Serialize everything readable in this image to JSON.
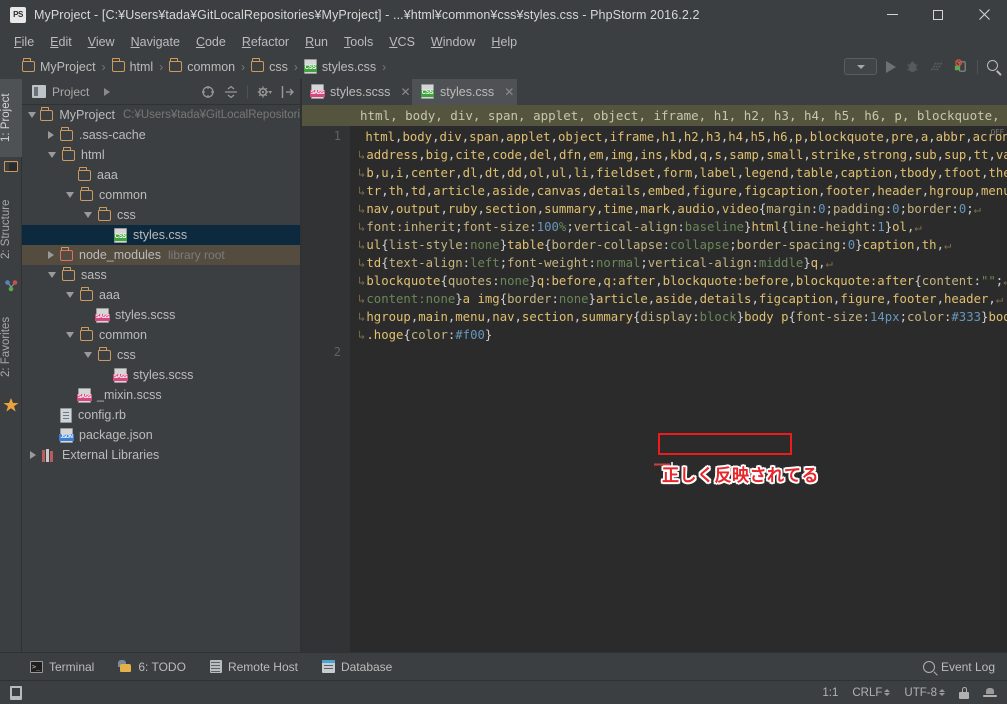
{
  "window": {
    "title": "MyProject - [C:¥Users¥tada¥GitLocalRepositories¥MyProject] - ...¥html¥common¥css¥styles.css - PhpStorm 2016.2.2",
    "app_icon_text": "PS",
    "minimize_label": "–",
    "maximize_label": "▫",
    "close_label": "✕"
  },
  "menubar": {
    "items": [
      {
        "label": "File"
      },
      {
        "label": "Edit"
      },
      {
        "label": "View"
      },
      {
        "label": "Navigate"
      },
      {
        "label": "Code"
      },
      {
        "label": "Refactor"
      },
      {
        "label": "Run"
      },
      {
        "label": "Tools"
      },
      {
        "label": "VCS"
      },
      {
        "label": "Window"
      },
      {
        "label": "Help"
      }
    ]
  },
  "breadcrumb": {
    "separator": "›",
    "items": [
      {
        "label": "MyProject",
        "icon": "folder-icon"
      },
      {
        "label": "html",
        "icon": "folder-icon"
      },
      {
        "label": "common",
        "icon": "folder-icon"
      },
      {
        "label": "css",
        "icon": "folder-icon"
      },
      {
        "label": "styles.css",
        "icon": "css-file-icon"
      }
    ]
  },
  "toolbar_right": {
    "run_config_label": "",
    "icons": [
      "run-config-dropdown",
      "run-icon",
      "debug-icon",
      "coverage-icon",
      "stop-profile-icon",
      "search-everywhere-icon"
    ]
  },
  "left_tool_tabs": [
    {
      "label": "1: Project",
      "active": true,
      "icon": "project-icon"
    },
    {
      "label": "2: Structure",
      "active": false,
      "icon": "structure-icon"
    },
    {
      "label": "2: Favorites",
      "active": false,
      "icon": "star-icon"
    }
  ],
  "project_panel": {
    "tab_label": "Project",
    "tools": [
      "collapse-target-icon",
      "collapse-all-icon",
      "settings-gear-icon",
      "hide-panel-icon"
    ],
    "tree": [
      {
        "depth": 0,
        "label": "MyProject",
        "note": "C:¥Users¥tada¥GitLocalRepositori",
        "expander": "down",
        "icon": "folder-icon"
      },
      {
        "depth": 1,
        "label": ".sass-cache",
        "expander": "right",
        "icon": "folder-icon"
      },
      {
        "depth": 1,
        "label": "html",
        "expander": "down",
        "icon": "folder-icon"
      },
      {
        "depth": 2,
        "label": "aaa",
        "expander": "none",
        "icon": "folder-icon"
      },
      {
        "depth": 2,
        "label": "common",
        "expander": "down",
        "icon": "folder-icon"
      },
      {
        "depth": 3,
        "label": "css",
        "expander": "down",
        "icon": "folder-icon"
      },
      {
        "depth": 4,
        "label": "styles.css",
        "expander": "none",
        "icon": "css-file-icon",
        "selected": true
      },
      {
        "depth": 1,
        "label": "node_modules",
        "note": "library root",
        "expander": "right",
        "icon": "folder-red-icon",
        "library": true
      },
      {
        "depth": 1,
        "label": "sass",
        "expander": "down",
        "icon": "folder-icon"
      },
      {
        "depth": 2,
        "label": "aaa",
        "expander": "down",
        "icon": "folder-icon"
      },
      {
        "depth": 3,
        "label": "styles.scss",
        "expander": "none",
        "icon": "sass-file-icon"
      },
      {
        "depth": 2,
        "label": "common",
        "expander": "down",
        "icon": "folder-icon"
      },
      {
        "depth": 3,
        "label": "css",
        "expander": "down",
        "icon": "folder-icon"
      },
      {
        "depth": 4,
        "label": "styles.scss",
        "expander": "none",
        "icon": "sass-file-icon"
      },
      {
        "depth": 2,
        "label": "_mixin.scss",
        "expander": "none",
        "icon": "sass-file-icon"
      },
      {
        "depth": 1,
        "label": "config.rb",
        "expander": "none",
        "icon": "ruby-file-icon"
      },
      {
        "depth": 1,
        "label": "package.json",
        "expander": "none",
        "icon": "json-file-icon"
      },
      {
        "depth": 0,
        "label": "External Libraries",
        "expander": "right",
        "icon": "library-icon"
      }
    ]
  },
  "editor_tabs": [
    {
      "label": "styles.scss",
      "icon": "sass-file-icon",
      "active": false,
      "close": "✕"
    },
    {
      "label": "styles.css",
      "icon": "css-file-icon",
      "active": true,
      "close": "✕"
    }
  ],
  "editor": {
    "sticky_header": "html, body, div, span, applet, object, iframe, h1, h2, h3, h4, h5, h6, p, blockquote, pre, ..",
    "off_badge": "OFF",
    "line_numbers": [
      "1",
      "2"
    ],
    "wrap_marker": "↳",
    "eol_marker": "↵",
    "code_lines": [
      "html,body,div,span,applet,object,iframe,h1,h2,h3,h4,h5,h6,p,blockquote,pre,a,abbr,acronym,",
      "address,big,cite,code,del,dfn,em,img,ins,kbd,q,s,samp,small,strike,strong,sub,sup,tt,var,",
      "b,u,i,center,dl,dt,dd,ol,ul,li,fieldset,form,label,legend,table,caption,tbody,tfoot,thead,",
      "tr,th,td,article,aside,canvas,details,embed,figure,figcaption,footer,header,hgroup,menu,",
      "nav,output,ruby,section,summary,time,mark,audio,video{margin:0;padding:0;border:0;",
      "font:inherit;font-size:100%;vertical-align:baseline}html{line-height:1}ol,",
      "ul{list-style:none}table{border-collapse:collapse;border-spacing:0}caption,th,",
      "td{text-align:left;font-weight:normal;vertical-align:middle}q,",
      "blockquote{quotes:none}q:before,q:after,blockquote:before,blockquote:after{content:\"\";",
      "content:none}a img{border:none}article,aside,details,figcaption,figure,footer,header,",
      "hgroup,main,menu,nav,section,summary{display:block}body p{font-size:14px;color:#333}body",
      ".hoge{color:#f00}"
    ],
    "annotation_text": "正しく反映されてる",
    "annotation_color": "#e8252a",
    "highlight_box_color": "#ee1b1b"
  },
  "bottom_bar": {
    "buttons": [
      {
        "label": "Terminal",
        "icon": "terminal-icon"
      },
      {
        "label": "6: TODO",
        "icon": "todo-icon"
      },
      {
        "label": "Remote Host",
        "icon": "remote-host-icon"
      },
      {
        "label": "Database",
        "icon": "database-icon"
      }
    ],
    "event_log": {
      "label": "Event Log",
      "icon": "search-icon"
    }
  },
  "status_bar": {
    "caret_position": "1:1",
    "line_separator": "CRLF",
    "encoding": "UTF-8",
    "icons": [
      "lock-icon",
      "inspection-icon"
    ]
  },
  "colors": {
    "chrome_bg": "#3c3f41",
    "editor_bg": "#2b2b2b",
    "gutter_bg": "#313335",
    "selection_bg": "#0d293e",
    "library_row_bg": "#534c3f",
    "sticky_header_bg": "#54543f",
    "accent_red": "#ee1b1b",
    "css_green": "#3ea33e",
    "sass_pink": "#d4487f"
  }
}
